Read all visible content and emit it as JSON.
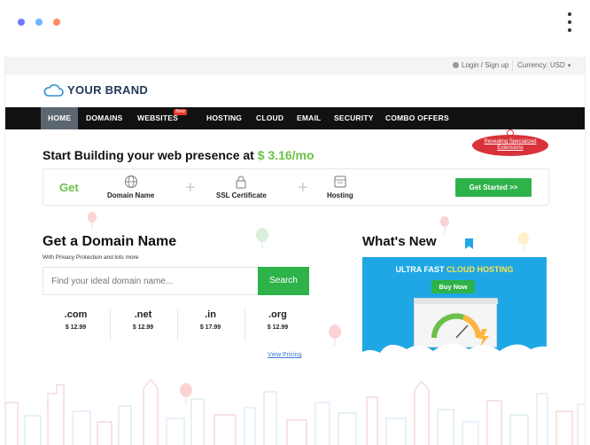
{
  "topbar": {
    "login_label": "Login / Sign up",
    "currency_label": "Currency: USD"
  },
  "brand": {
    "name": "YOUR BRAND"
  },
  "nav": {
    "items": [
      {
        "label": "HOME",
        "active": true
      },
      {
        "label": "DOMAINS"
      },
      {
        "label": "WEBSITES",
        "badge": "New"
      },
      {
        "label": "HOSTING"
      },
      {
        "label": "CLOUD"
      },
      {
        "label": "EMAIL"
      },
      {
        "label": "SECURITY"
      },
      {
        "label": "COMBO OFFERS"
      }
    ]
  },
  "hero": {
    "headline_prefix": "Start Building your web presence at",
    "headline_price": "$ 3.16/mo",
    "ribbon_text": "Revealing Specialized Extensions"
  },
  "getbar": {
    "get_label": "Get",
    "features": [
      "Domain Name",
      "SSL Certificate",
      "Hosting"
    ],
    "cta_label": "Get Started >>"
  },
  "domain": {
    "title": "Get a Domain Name",
    "subtitle": "With Privacy Protection and lots more",
    "search_placeholder": "Find your ideal domain name...",
    "search_button": "Search",
    "tlds": [
      {
        "name": ".com",
        "price": "$ 12.99"
      },
      {
        "name": ".net",
        "price": "$ 12.99"
      },
      {
        "name": ".in",
        "price": "$ 17.99"
      },
      {
        "name": ".org",
        "price": "$ 12.99"
      }
    ],
    "view_pricing": "View Pricing"
  },
  "whats_new": {
    "title": "What's New",
    "promo_prefix": "ULTRA FAST",
    "promo_highlight": "CLOUD HOSTING",
    "buy_label": "Buy Now"
  },
  "colors": {
    "accent_green": "#2eb24a",
    "price_green": "#6cc04a",
    "nav_bg": "#111111",
    "promo_blue": "#1fa7e5",
    "ribbon_red": "#d9323a"
  }
}
